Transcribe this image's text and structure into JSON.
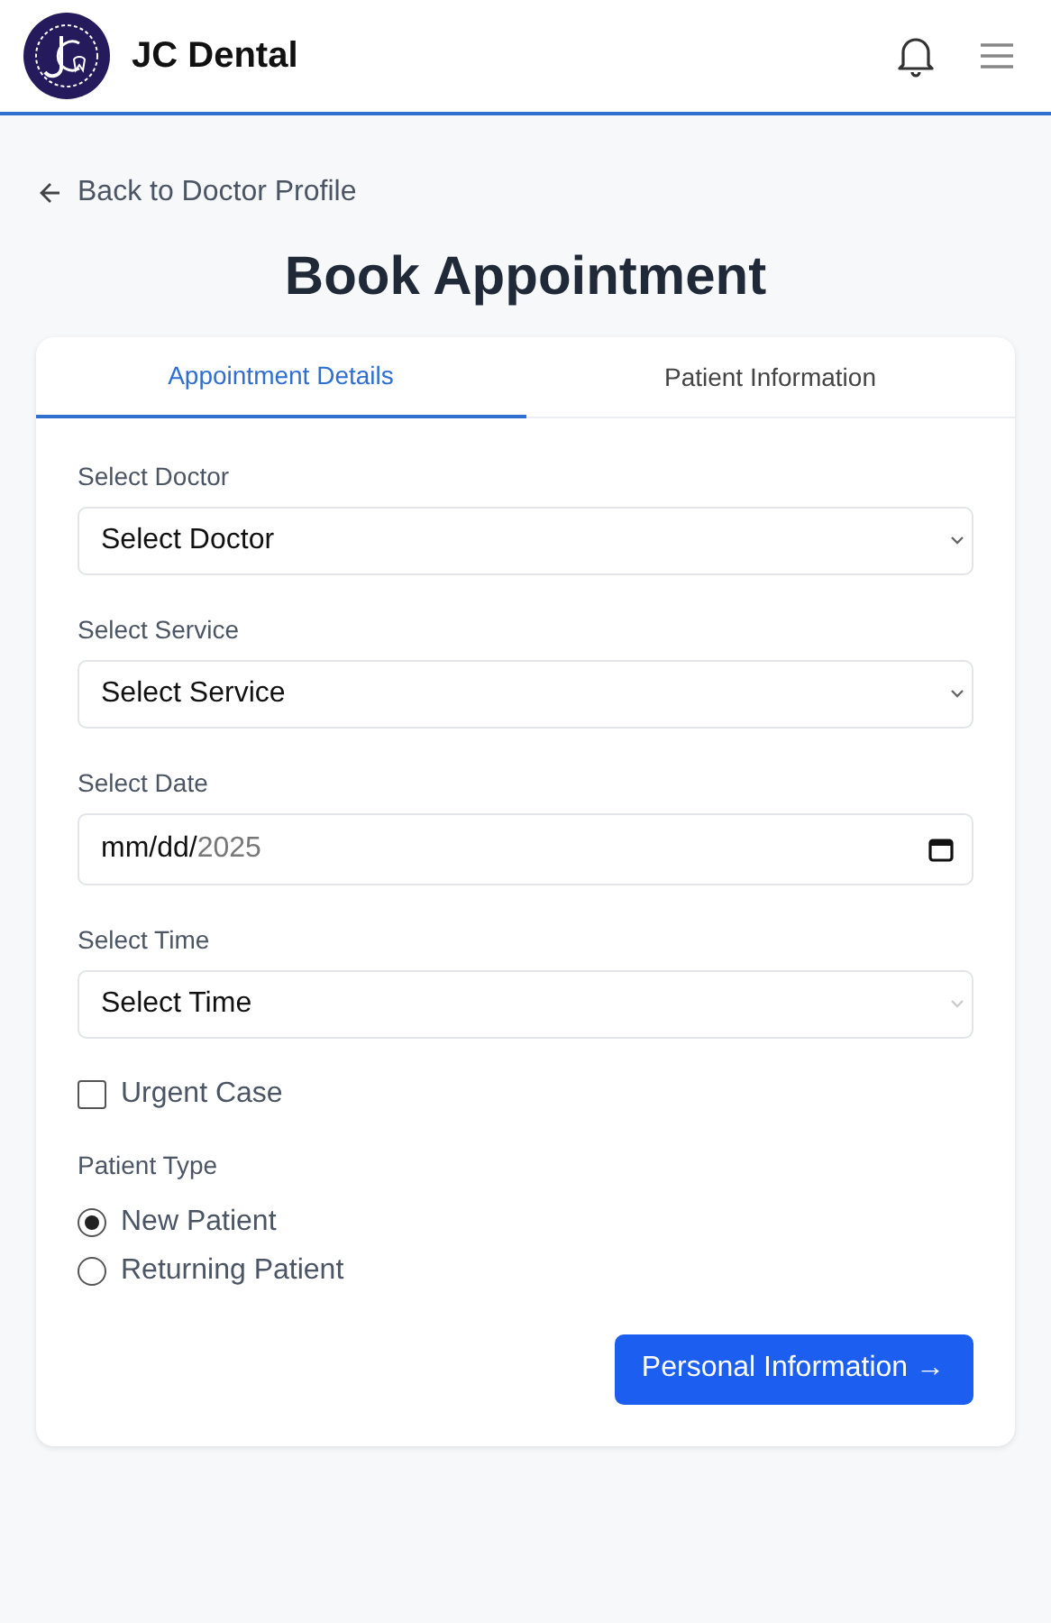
{
  "header": {
    "title": "JC Dental"
  },
  "back_link": "Back to Doctor Profile",
  "page_title": "Book Appointment",
  "tabs": [
    {
      "label": "Appointment Details",
      "selected": true
    },
    {
      "label": "Patient Information",
      "selected": false
    }
  ],
  "fields": [
    {
      "kind": "select",
      "label": "Select Doctor",
      "value": "Select Doctor",
      "disabled": false
    },
    {
      "kind": "select",
      "label": "Select Service",
      "value": "Select Service",
      "disabled": false
    },
    {
      "kind": "date",
      "label": "Select Date",
      "value": "mm/dd/",
      "year": "2025"
    },
    {
      "kind": "select",
      "label": "Select Time",
      "value": "Select Time",
      "disabled": true
    }
  ],
  "urgent": {
    "label": "Urgent Case",
    "checked": false
  },
  "patient_type": {
    "label": "Patient Type",
    "options": [
      {
        "label": "New Patient",
        "selected": true
      },
      {
        "label": "Returning Patient",
        "selected": false
      }
    ]
  },
  "next_button": "Personal Information →"
}
